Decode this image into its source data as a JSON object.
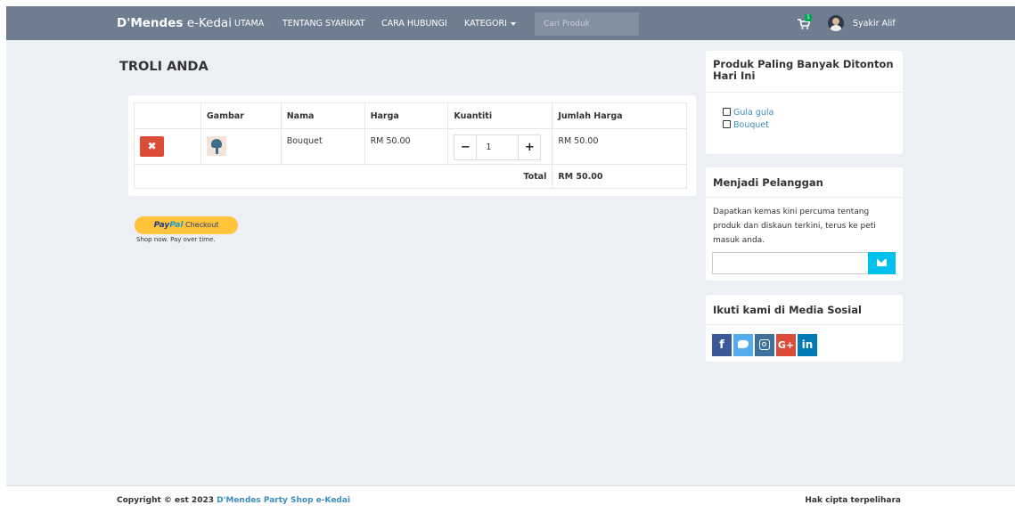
{
  "navbar": {
    "brand_bold": "D'Mendes",
    "brand_rest": " e-Kedai",
    "menu": [
      "UTAMA",
      "TENTANG SYARIKAT",
      "CARA HUBUNGI",
      "KATEGORI"
    ],
    "search_placeholder": "Cari Produk",
    "cart_badge": "1",
    "username": "Syakir Alif"
  },
  "cart": {
    "title": "TROLI ANDA",
    "headers": [
      "",
      "Gambar",
      "Nama",
      "Harga",
      "Kuantiti",
      "Jumlah Harga"
    ],
    "items": [
      {
        "name": "Bouquet",
        "price": "RM 50.00",
        "quantity": "1",
        "subtotal": "RM 50.00"
      }
    ],
    "total_label": "Total",
    "total_value": "RM 50.00",
    "paypal": {
      "brand1": "Pay",
      "brand2": "Pal",
      "action": "Checkout",
      "tagline": "Shop now. Pay over time."
    }
  },
  "sidebar": {
    "popular": {
      "title": "Produk Paling Banyak Ditonton Hari Ini",
      "items": [
        "Gula gula",
        "Bouquet"
      ]
    },
    "subscribe": {
      "title": "Menjadi Pelanggan",
      "text": "Dapatkan kemas kini percuma tentang produk dan diskaun terkini, terus ke peti masuk anda.",
      "email_value": ""
    },
    "social": {
      "title": "Ikuti kami di Media Sosial",
      "networks": [
        "facebook",
        "twitter",
        "instagram",
        "google-plus",
        "linkedin"
      ],
      "colors": {
        "facebook": "#3b5998",
        "twitter": "#55acee",
        "instagram": "#3f729b",
        "google-plus": "#dd4b39",
        "linkedin": "#007bb6"
      }
    }
  },
  "footer": {
    "copyright_prefix": "Copyright © est 2023 ",
    "shop_name": "D'Mendes Party Shop e-Kedai",
    "rights": "Hak cipta terpelihara"
  },
  "colors": {
    "navbar": "#6e7d8f",
    "background": "#ecf0f5",
    "danger": "#dd4b39",
    "info": "#00c0ef",
    "link": "#3c8dbc"
  }
}
